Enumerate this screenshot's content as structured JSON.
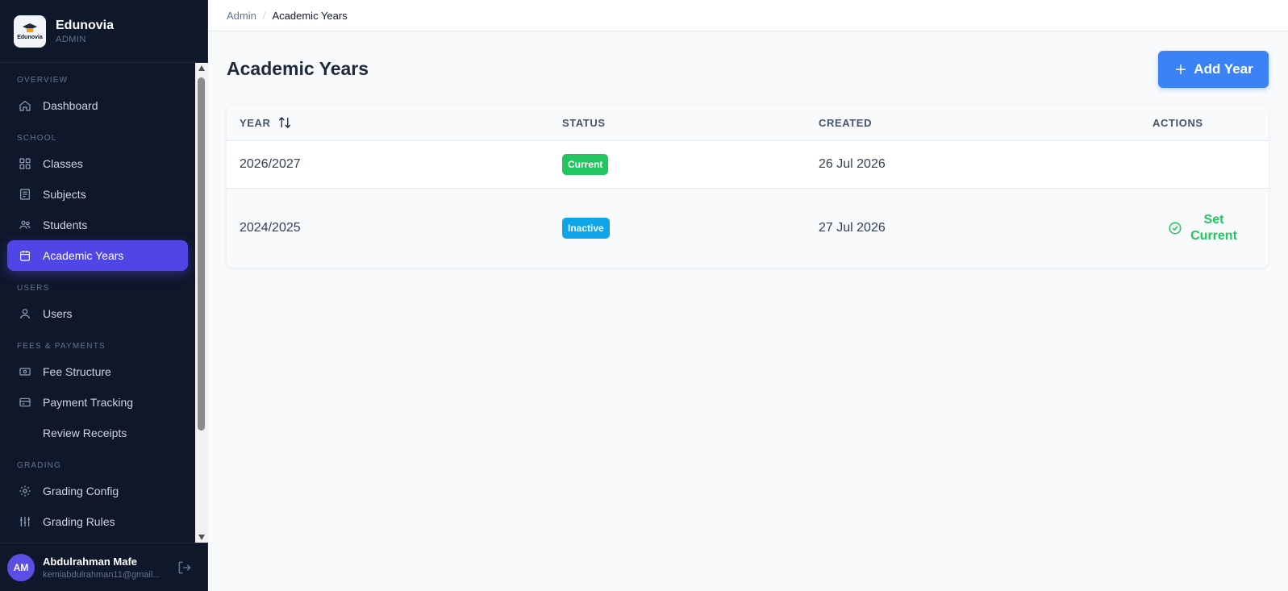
{
  "brand": {
    "name": "Edunovia",
    "role": "ADMIN",
    "logo_text": "Edunovia"
  },
  "sidebar": {
    "sections": [
      {
        "title": "OVERVIEW",
        "items": [
          {
            "label": "Dashboard",
            "icon": "home-icon"
          }
        ]
      },
      {
        "title": "SCHOOL",
        "items": [
          {
            "label": "Classes",
            "icon": "grid-icon"
          },
          {
            "label": "Subjects",
            "icon": "book-icon"
          },
          {
            "label": "Students",
            "icon": "users-icon"
          },
          {
            "label": "Academic Years",
            "icon": "calendar-icon",
            "active": true
          }
        ]
      },
      {
        "title": "USERS",
        "items": [
          {
            "label": "Users",
            "icon": "user-icon"
          }
        ]
      },
      {
        "title": "FEES & PAYMENTS",
        "items": [
          {
            "label": "Fee Structure",
            "icon": "money-icon"
          },
          {
            "label": "Payment Tracking",
            "icon": "card-icon"
          },
          {
            "label": "Review Receipts",
            "icon": ""
          }
        ]
      },
      {
        "title": "GRADING",
        "items": [
          {
            "label": "Grading Config",
            "icon": "gear-icon"
          },
          {
            "label": "Grading Rules",
            "icon": "sliders-icon"
          }
        ]
      }
    ]
  },
  "user": {
    "initials": "AM",
    "name": "Abdulrahman Mafe",
    "email": "kemiabdulrahman11@gmail..."
  },
  "breadcrumb": {
    "root": "Admin",
    "separator": "/",
    "current": "Academic Years"
  },
  "page": {
    "title": "Academic Years",
    "add_button": "Add Year"
  },
  "table": {
    "headers": {
      "year": "YEAR",
      "status": "STATUS",
      "created": "CREATED",
      "actions": "ACTIONS"
    },
    "rows": [
      {
        "year": "2026/2027",
        "status": "Current",
        "created": "26 Jul 2026",
        "action": ""
      },
      {
        "year": "2024/2025",
        "status": "Inactive",
        "created": "27 Jul 2026",
        "action": "Set Current"
      }
    ]
  },
  "colors": {
    "accent": "#5046e5",
    "primary_button": "#3b82f6",
    "success": "#22c55e",
    "info": "#0ea5e9",
    "sidebar_bg": "#0f172a"
  }
}
